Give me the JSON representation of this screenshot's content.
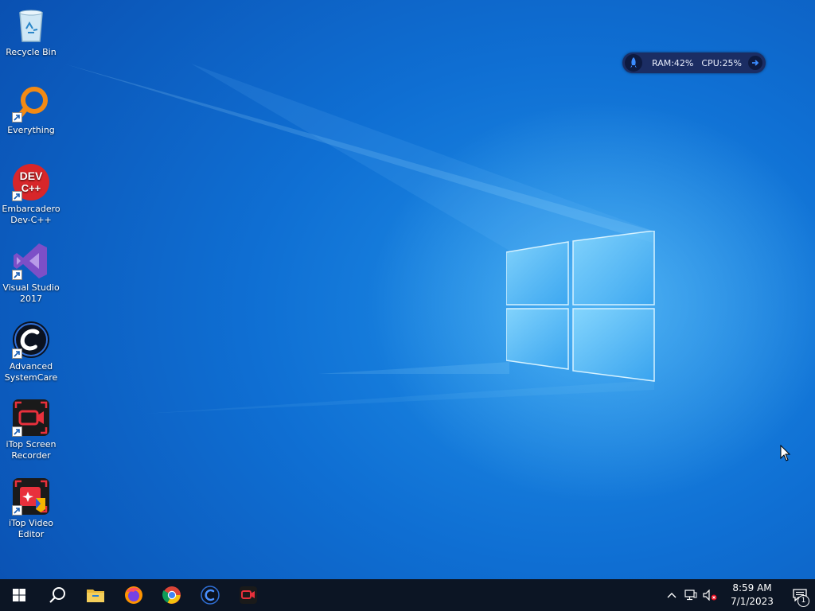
{
  "desktop": {
    "icons": [
      {
        "label": "Recycle Bin",
        "icon": "recycle-bin-icon"
      },
      {
        "label": "Everything",
        "icon": "everything-search-icon"
      },
      {
        "label": "Embarcadero Dev-C++",
        "icon": "dev-cpp-icon",
        "logo_text": "DEV C++"
      },
      {
        "label": "Visual Studio 2017",
        "icon": "visual-studio-icon"
      },
      {
        "label": "Advanced SystemCare",
        "icon": "advanced-systemcare-icon"
      },
      {
        "label": "iTop Screen Recorder",
        "icon": "itop-screen-recorder-icon"
      },
      {
        "label": "iTop Video Editor",
        "icon": "itop-video-editor-icon"
      }
    ]
  },
  "widget": {
    "ram": "RAM:42%",
    "cpu": "CPU:25%",
    "colors": {
      "background": "#1b2d63",
      "text": "#e8eefc"
    }
  },
  "taskbar": {
    "items": [
      {
        "name": "start",
        "icon": "windows-start-icon"
      },
      {
        "name": "search",
        "icon": "search-icon"
      },
      {
        "name": "file-explorer",
        "icon": "folder-icon"
      },
      {
        "name": "firefox",
        "icon": "firefox-icon"
      },
      {
        "name": "chrome",
        "icon": "chrome-icon"
      },
      {
        "name": "advanced-systemcare",
        "icon": "advanced-systemcare-icon"
      },
      {
        "name": "itop-screen-recorder",
        "icon": "itop-screen-recorder-icon"
      }
    ],
    "tray": {
      "time": "8:59 AM",
      "date": "7/1/2023",
      "notification_count": "1"
    },
    "colors": {
      "background": "#0c1524"
    }
  }
}
